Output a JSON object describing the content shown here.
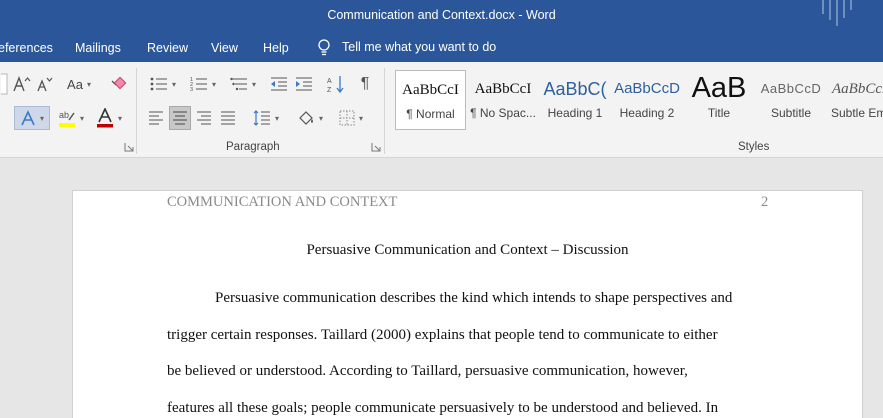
{
  "window": {
    "title": "Communication and Context.docx  -  Word"
  },
  "tabs": [
    {
      "label": "eferences"
    },
    {
      "label": "Mailings"
    },
    {
      "label": "Review"
    },
    {
      "label": "View"
    },
    {
      "label": "Help"
    }
  ],
  "tell_me": {
    "text": "Tell me what you want to do",
    "icon": "lightbulb-icon"
  },
  "ribbon": {
    "font": {
      "change_case_label": "Aa"
    },
    "paragraph": {
      "label": "Paragraph"
    },
    "styles": {
      "label": "Styles",
      "items": [
        {
          "sample": "AaBbCcI",
          "name": "¶ Normal"
        },
        {
          "sample": "AaBbCcI",
          "name": "¶ No Spac..."
        },
        {
          "sample": "AaBbC(",
          "name": "Heading 1"
        },
        {
          "sample": "AaBbCcD",
          "name": "Heading 2"
        },
        {
          "sample": "AaB",
          "name": "Title"
        },
        {
          "sample": "AaBbCcD",
          "name": "Subtitle"
        },
        {
          "sample": "AaBbCcD",
          "name": "Subtle Em"
        }
      ]
    },
    "colors": {
      "highlight": "#ffff00",
      "font_color": "#c00000",
      "accent": "#2b579a"
    }
  },
  "document": {
    "header_left": "COMMUNICATION AND CONTEXT",
    "header_right": "2",
    "title": "Persuasive Communication and Context – Discussion",
    "lines": [
      "Persuasive communication describes the kind which intends to shape perspectives and",
      "trigger certain responses. Taillard (2000) explains that people tend to communicate to either",
      "be believed or understood. According to Taillard, persuasive communication, however,",
      "features all these goals; people communicate persuasively to be understood and believed. In"
    ]
  }
}
